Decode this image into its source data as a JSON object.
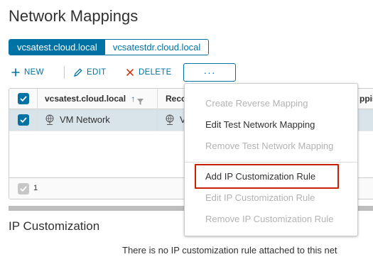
{
  "page": {
    "title": "Network Mappings"
  },
  "site_toggle": {
    "sites": [
      "vcsatest.cloud.local",
      "vcsatestdr.cloud.local"
    ],
    "active": "vcsatest.cloud.local"
  },
  "toolbar": {
    "new_label": "NEW",
    "edit_label": "EDIT",
    "delete_label": "DELETE",
    "more_label": "···"
  },
  "grid": {
    "columns": [
      "vcsatest.cloud.local",
      "Reco",
      "ppin"
    ],
    "sort_indicator": "↑",
    "rows": [
      {
        "name": "VM Network",
        "recovery_partial": "V",
        "selected": true
      }
    ],
    "footer_count": "1"
  },
  "menu": {
    "items": [
      {
        "label": "Create Reverse Mapping",
        "enabled": false
      },
      {
        "label": "Edit Test Network Mapping",
        "enabled": true
      },
      {
        "label": "Remove Test Network Mapping",
        "enabled": false
      },
      {
        "label": "Add IP Customization Rule",
        "enabled": true,
        "highlighted": true
      },
      {
        "label": "Edit IP Customization Rule",
        "enabled": false
      },
      {
        "label": "Remove IP Customization Rule",
        "enabled": false
      }
    ]
  },
  "ip_customization": {
    "title": "IP Customization",
    "empty_message": "There is no IP customization rule attached to this net"
  },
  "colors": {
    "accent": "#0072a3",
    "selected_row": "#d9e4ea",
    "highlight_border": "#c92100",
    "disabled_text": "#b3b3b3"
  },
  "icons": {
    "new": "plus-icon",
    "edit": "pencil-icon",
    "delete": "x-icon",
    "network": "network-globe-icon",
    "filter": "filter-icon",
    "check": "check-icon"
  }
}
